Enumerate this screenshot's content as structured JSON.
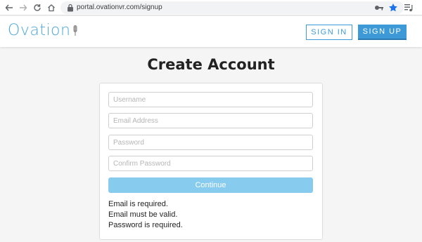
{
  "browser": {
    "url": "portal.ovationvr.com/signup",
    "icons": [
      "back-arrow-icon",
      "forward-arrow-icon",
      "reload-icon",
      "home-icon",
      "lock-icon",
      "key-icon",
      "star-icon",
      "playlist-icon"
    ],
    "star_color": "#1a73e8"
  },
  "header": {
    "logo_text": "Ovation",
    "signin_label": "SIGN IN",
    "signup_label": "SIGN UP",
    "accent_color": "#3d9ad6"
  },
  "main": {
    "title": "Create Account",
    "form": {
      "username_placeholder": "Username",
      "email_placeholder": "Email Address",
      "password_placeholder": "Password",
      "confirm_placeholder": "Confirm Password",
      "continue_label": "Continue"
    },
    "errors": [
      "Email is required.",
      "Email must be valid.",
      "Password is required."
    ]
  }
}
